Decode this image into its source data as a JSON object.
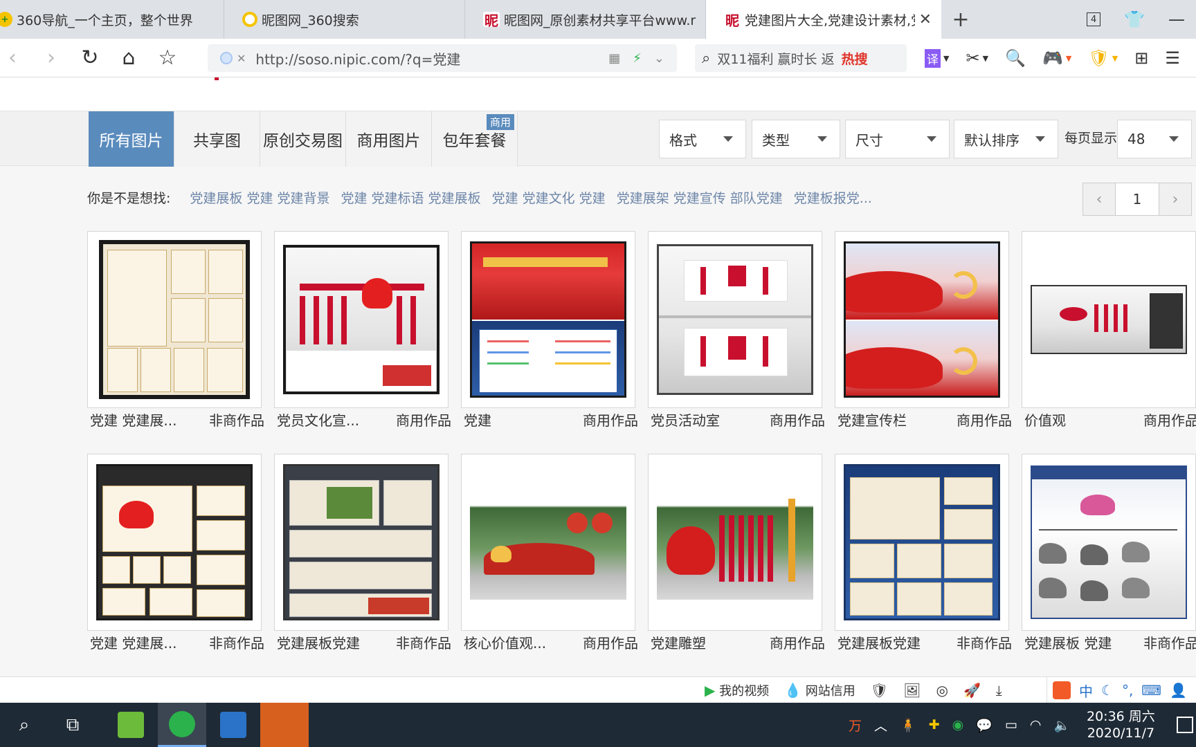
{
  "browser": {
    "tabs": [
      {
        "title": "360导航_一个主页，整个世界",
        "icon": "360-icon"
      },
      {
        "title": "昵图网_360搜索",
        "icon": "360-search-icon"
      },
      {
        "title": "昵图网_原创素材共享平台www.r",
        "icon": "nipic-icon"
      },
      {
        "title": "党建图片大全,党建设计素材,党建",
        "icon": "nipic-icon",
        "active": true
      }
    ],
    "tab_count": "4",
    "url": "http://soso.nipic.com/?q=党建",
    "search_placeholder": "双11福利 赢时长 返",
    "search_hot": "热搜"
  },
  "categories": [
    {
      "label": "所有图片",
      "active": true
    },
    {
      "label": "共享图"
    },
    {
      "label": "原创交易图"
    },
    {
      "label": "商用图片"
    },
    {
      "label": "包年套餐",
      "badge": "商用"
    }
  ],
  "filters": {
    "format": "格式",
    "type": "类型",
    "size": "尺寸",
    "sort": "默认排序",
    "per_page_label": "每页显示",
    "per_page_value": "48"
  },
  "suggest": {
    "label": "你是不是想找:",
    "keywords": [
      "党建展板 党建 党建背景",
      "党建 党建标语 党建展板",
      "党建 党建文化 党建",
      "党建展架 党建宣传 部队党建",
      "党建板报党..."
    ]
  },
  "pager": {
    "prev": "‹",
    "page": "1",
    "next": "›"
  },
  "results": [
    {
      "title": "党建 党建展...",
      "tag": "非商作品",
      "thumb": "poster"
    },
    {
      "title": "党员文化宣...",
      "tag": "商用作品",
      "thumb": "wall"
    },
    {
      "title": "党建",
      "tag": "商用作品",
      "thumb": "red"
    },
    {
      "title": "党员活动室",
      "tag": "商用作品",
      "thumb": "room"
    },
    {
      "title": "党建宣传栏",
      "tag": "商用作品",
      "thumb": "redflag"
    },
    {
      "title": "价值观",
      "tag": "商用作品",
      "thumb": "wide"
    },
    {
      "title": "党建 党建展...",
      "tag": "非商作品",
      "thumb": "poster2"
    },
    {
      "title": "党建展板党建",
      "tag": "非商作品",
      "thumb": "dark"
    },
    {
      "title": "核心价值观...",
      "tag": "商用作品",
      "thumb": "outdoor"
    },
    {
      "title": "党建雕塑",
      "tag": "商用作品",
      "thumb": "outdoor2"
    },
    {
      "title": "党建展板党建",
      "tag": "非商作品",
      "thumb": "blue"
    },
    {
      "title": "党建展板 党建",
      "tag": "非商作品",
      "thumb": "ink"
    }
  ],
  "statusbar": {
    "video": "我的视频",
    "credit": "网站信用",
    "ime_lang": "中"
  },
  "taskbar": {
    "time": "20:36 周六",
    "date": "2020/11/7"
  },
  "colors": {
    "accent": "#5a8bbd",
    "link": "#6d86a8",
    "party_red": "#c8102e"
  }
}
